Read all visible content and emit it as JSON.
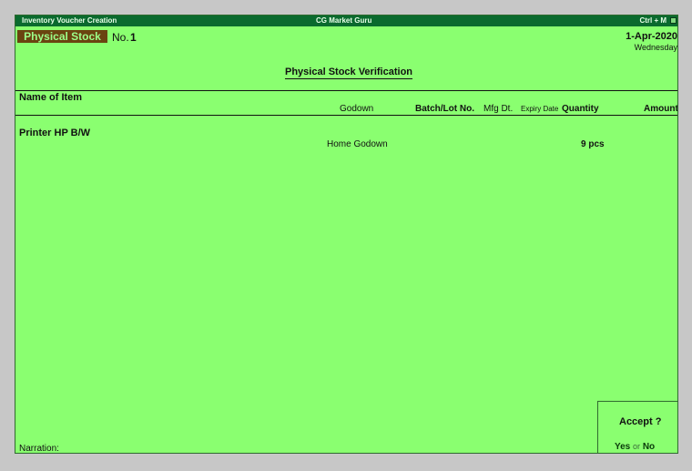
{
  "titlebar": {
    "left": "Inventory Voucher  Creation",
    "center": "CG Market Guru",
    "right": "Ctrl + M"
  },
  "voucher": {
    "type": "Physical Stock",
    "no_label": "No.",
    "no_value": "1",
    "date": "1-Apr-2020",
    "day": "Wednesday",
    "title": "Physical Stock Verification"
  },
  "columns": {
    "name": "Name of Item",
    "godown": "Godown",
    "batch": "Batch/Lot No.",
    "mfg": "Mfg Dt.",
    "expiry": "Expiry Date",
    "quantity": "Quantity",
    "amount": "Amount"
  },
  "items": [
    {
      "name": "Printer HP B/W",
      "godown": "Home Godown",
      "quantity": "9 pcs"
    }
  ],
  "narration_label": "Narration:",
  "accept": {
    "title": "Accept ?",
    "yes": "Yes",
    "or": "or",
    "no": "No"
  }
}
